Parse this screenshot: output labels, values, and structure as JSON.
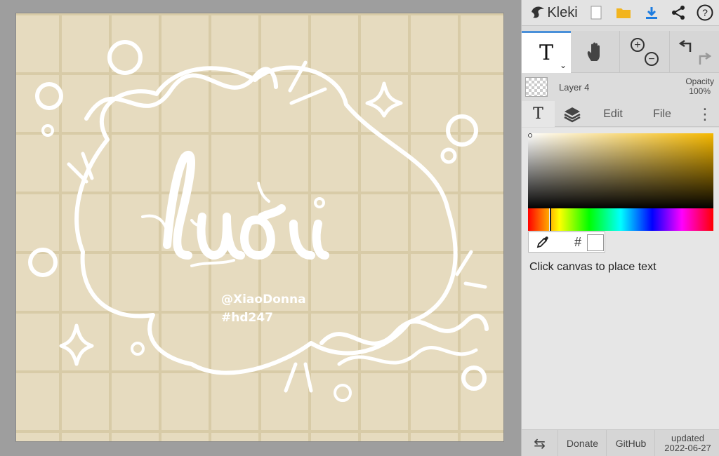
{
  "app": {
    "logo_text": "Kleki"
  },
  "canvas": {
    "artwork_text": "lười",
    "handle_line1": "@XiaoDonna",
    "handle_line2": "#hd247",
    "bg_color": "#e6dbbf",
    "grid_color": "#d8cba7",
    "stroke_color": "#ffffff"
  },
  "topbar": {
    "icons": [
      "kleki-logo-icon",
      "new-file-icon",
      "open-folder-icon",
      "download-icon",
      "share-icon",
      "help-icon"
    ],
    "help_label": "?"
  },
  "tools": {
    "text_tool_label": "T",
    "caret": "⌄",
    "zoom_in": "+",
    "zoom_out": "−"
  },
  "layer": {
    "name": "Layer 4",
    "opacity_label": "Opacity",
    "opacity_value": "100%"
  },
  "tabs": {
    "text": "T",
    "edit": "Edit",
    "file": "File",
    "more": "⋮"
  },
  "color": {
    "hex_label": "#",
    "current": "#ffffff",
    "gradient_base": "#f5b800"
  },
  "hint": "Click canvas to place text",
  "bottom": {
    "swap": "⇆",
    "donate": "Donate",
    "github": "GitHub",
    "updated_label": "updated",
    "updated_date": "2022-06-27"
  }
}
